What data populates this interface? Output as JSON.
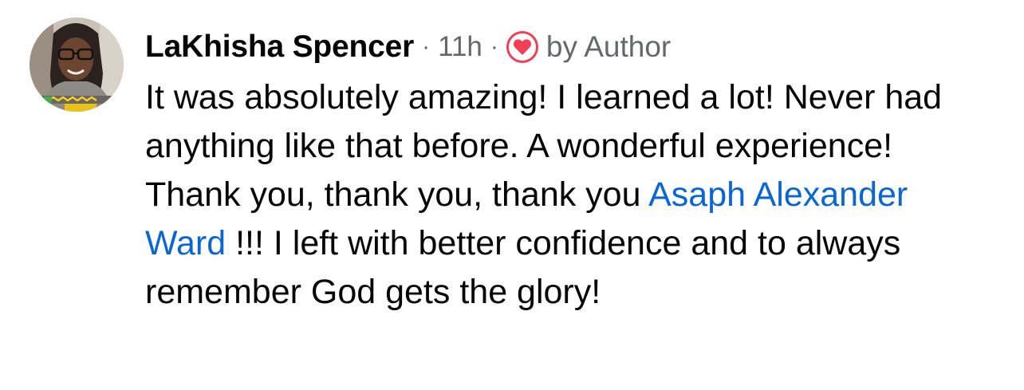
{
  "comment": {
    "author": "LaKhisha Spencer",
    "separator1": "·",
    "time": "11h",
    "separator2": "·",
    "reaction_icon": "heart-icon",
    "reaction_label": "by Author",
    "text_part1": "It was absolutely amazing! I learned a lot! Never had anything like that before. A wonderful experience! Thank you, thank you, thank you ",
    "mention": "Asaph Alexander Ward",
    "text_part2": " !!! I left with better confidence and to always remember God gets the glory!"
  },
  "colors": {
    "text": "#050505",
    "meta": "#65676b",
    "mention": "#0866d6",
    "heart": "#f33e58"
  }
}
